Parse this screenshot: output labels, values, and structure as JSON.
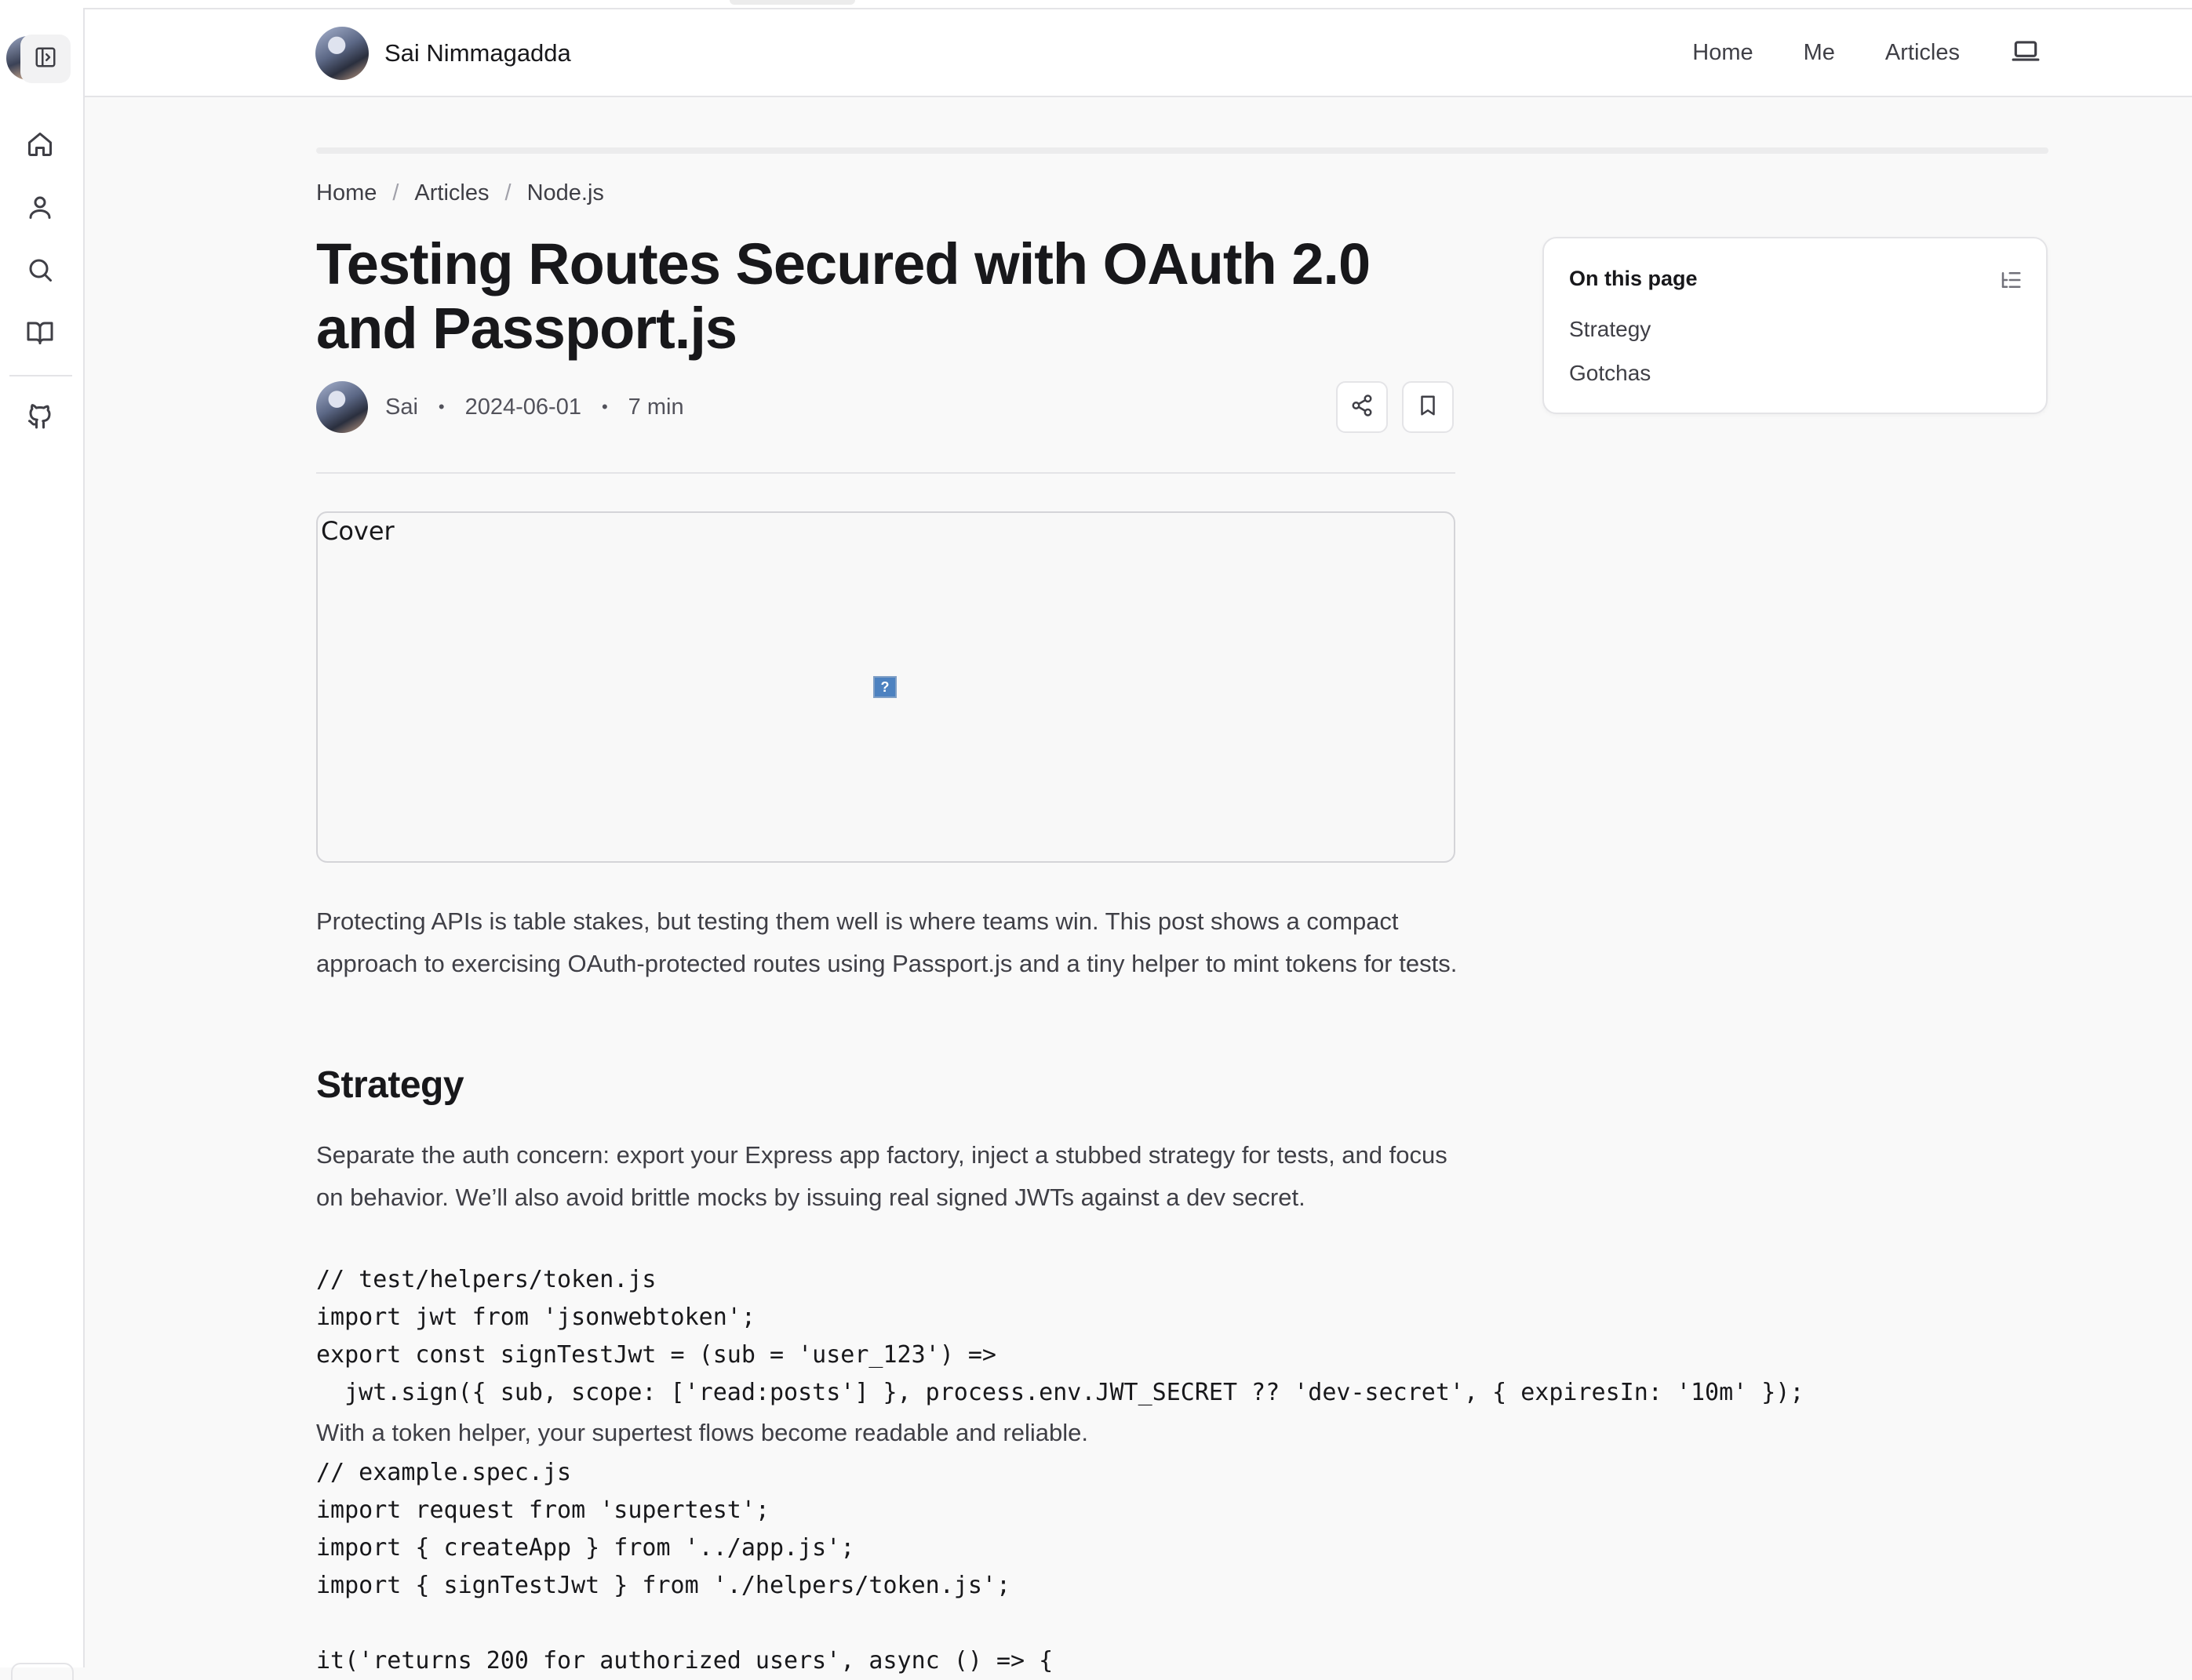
{
  "site": {
    "name": "Sai Nimmagadda"
  },
  "nav": {
    "items": [
      "Home",
      "Me",
      "Articles"
    ]
  },
  "breadcrumb": {
    "items": [
      "Home",
      "Articles",
      "Node.js"
    ],
    "separator": "/"
  },
  "article": {
    "title": "Testing Routes Secured with OAuth 2.0 and Passport.js",
    "author": "Sai",
    "date": "2024-06-01",
    "read_time": "7 min",
    "dot": "•",
    "cover_label": "Cover",
    "broken_image_glyph": "?",
    "intro": "Protecting APIs is table stakes, but testing them well is where teams win. This post shows a compact approach to exercising OAuth-protected routes using Passport.js and a tiny helper to mint tokens for tests.",
    "heading_strategy": "Strategy",
    "strategy_text": "Separate the auth concern: export your Express app factory, inject a stubbed strategy for tests, and focus on behavior. We’ll also avoid brittle mocks by issuing real signed JWTs against a dev secret.",
    "code1": "// test/helpers/token.js\nimport jwt from 'jsonwebtoken';\nexport const signTestJwt = (sub = 'user_123') =>\n  jwt.sign({ sub, scope: ['read:posts'] }, process.env.JWT_SECRET ?? 'dev-secret', { expiresIn: '10m' });",
    "between_text": "With a token helper, your supertest flows become readable and reliable.",
    "code2": "// example.spec.js\nimport request from 'supertest';\nimport { createApp } from '../app.js';\nimport { signTestJwt } from './helpers/token.js';\n\nit('returns 200 for authorized users', async () => {"
  },
  "toc": {
    "title": "On this page",
    "items": [
      "Strategy",
      "Gotchas"
    ]
  },
  "icons": {
    "sidebar": [
      "sidebar-toggle-icon",
      "home-icon",
      "user-icon",
      "search-icon",
      "book-icon",
      "github-icon"
    ],
    "header": [
      "laptop-icon"
    ],
    "actions": [
      "share-icon",
      "bookmark-icon"
    ],
    "toc": [
      "list-tree-icon"
    ]
  },
  "colors": {
    "background": "#f9f9f9",
    "text": "#18181b",
    "muted": "#3f3f46",
    "border": "#e4e4e7"
  }
}
